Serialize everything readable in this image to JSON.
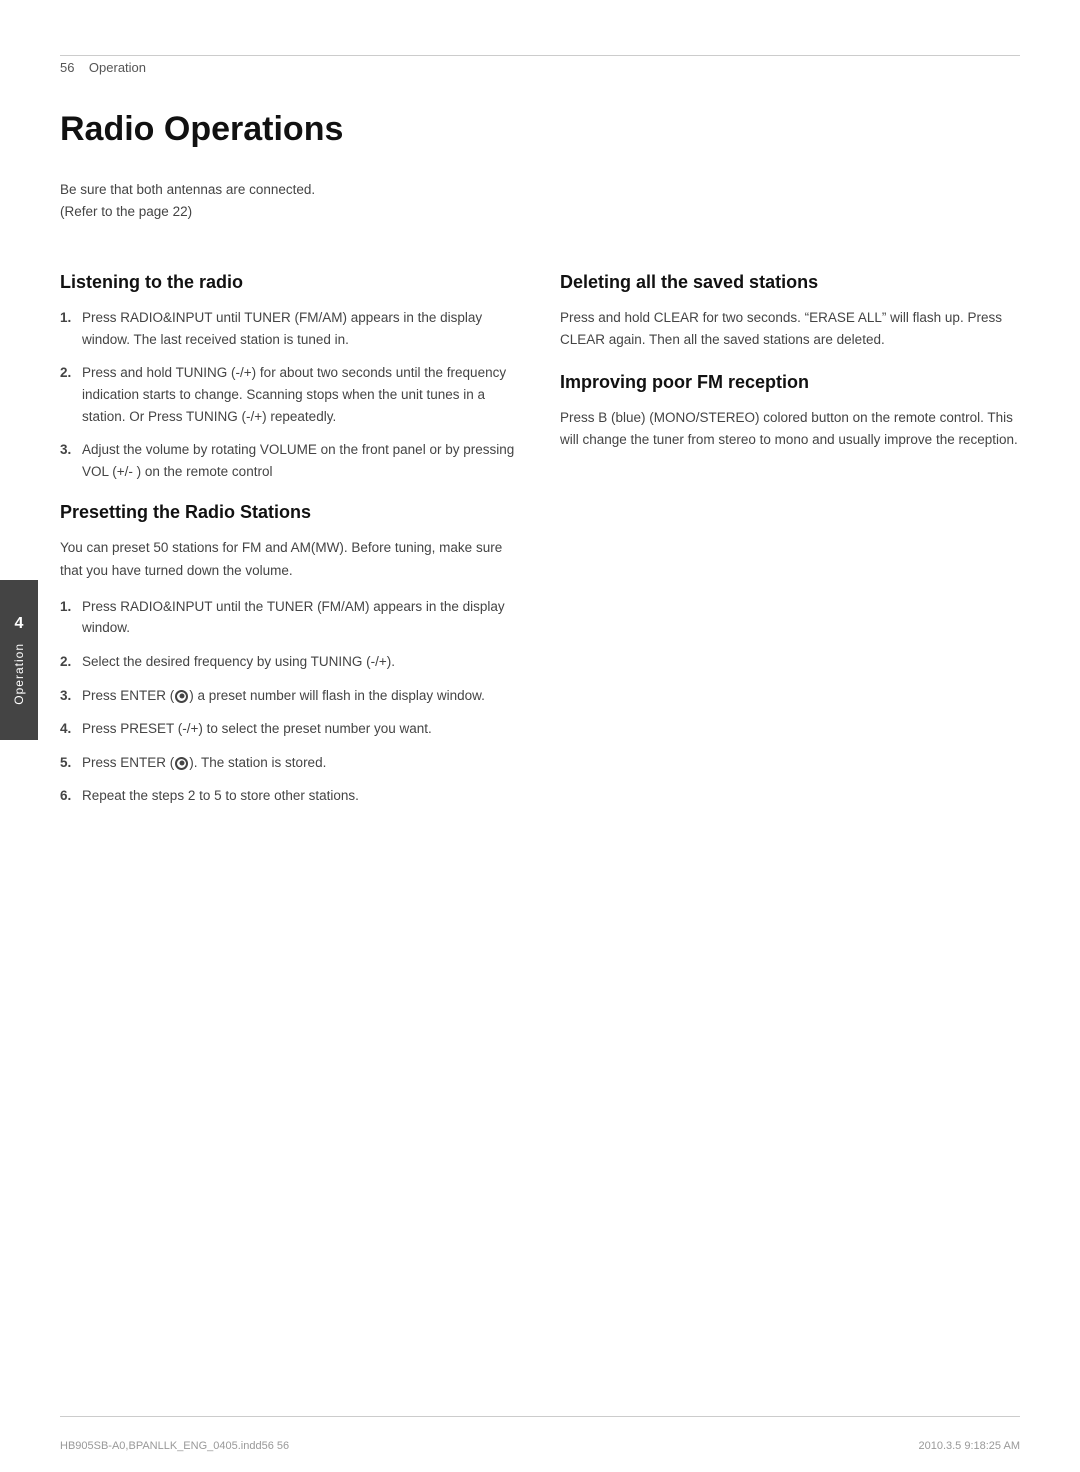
{
  "header": {
    "page_number": "56",
    "page_label": "Operation"
  },
  "page_title": "Radio Operations",
  "intro": {
    "text": "Be sure that both antennas are connected.\n(Refer to the page 22)"
  },
  "left_column": {
    "section1": {
      "title": "Listening to the radio",
      "steps": [
        {
          "num": "1.",
          "text": "Press RADIO&INPUT until TUNER (FM/AM) appears in the display window. The last received station is tuned in."
        },
        {
          "num": "2.",
          "text": "Press and hold TUNING (-/+) for about two seconds until the frequency indication starts to change. Scanning stops when the unit tunes in a station. Or Press TUNING (-/+) repeatedly."
        },
        {
          "num": "3.",
          "text": "Adjust the volume by rotating VOLUME on the front panel or by pressing VOL (+/- ) on the remote control"
        }
      ]
    },
    "section2": {
      "title": "Presetting the Radio Stations",
      "intro": "You can preset 50 stations for FM and AM(MW). Before tuning, make sure that you have turned down the volume.",
      "steps": [
        {
          "num": "1.",
          "text": "Press RADIO&INPUT until the TUNER (FM/AM) appears in the display window."
        },
        {
          "num": "2.",
          "text": "Select the desired frequency by using TUNING (-/+)."
        },
        {
          "num": "3.",
          "text": "Press ENTER (●) a preset number will flash in the display window."
        },
        {
          "num": "4.",
          "text": "Press PRESET (-/+) to select the preset number you want."
        },
        {
          "num": "5.",
          "text": "Press ENTER (●). The station is stored."
        },
        {
          "num": "6.",
          "text": "Repeat the steps 2 to 5 to store other stations."
        }
      ]
    }
  },
  "right_column": {
    "section1": {
      "title": "Deleting all the saved stations",
      "text": "Press and hold CLEAR for two seconds. \"ERASE ALL\" will flash up. Press CLEAR again. Then all the saved stations are deleted."
    },
    "section2": {
      "title": "Improving poor FM reception",
      "text": "Press B (blue) (MONO/STEREO) colored button on the remote control. This will change the tuner from stereo to mono and usually improve the reception."
    }
  },
  "sidebar": {
    "number": "4",
    "label": "Operation"
  },
  "footer": {
    "left": "HB905SB-A0,BPANLLK_ENG_0405.indd56   56",
    "right": "2010.3.5   9:18:25 AM"
  }
}
